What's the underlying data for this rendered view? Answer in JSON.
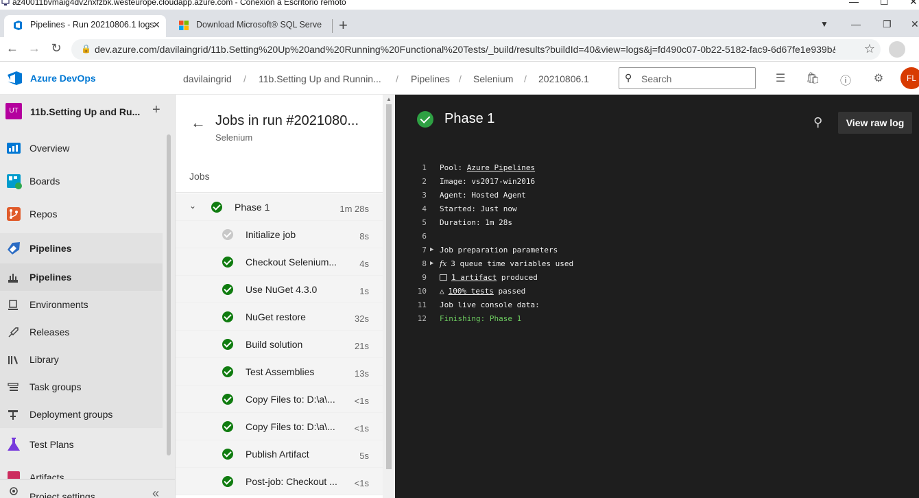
{
  "rdp": {
    "title": "az40011bvmaig4dv2nxfzbk.westeurope.cloudapp.azure.com - Conexión a Escritorio remoto"
  },
  "browser": {
    "tabs": [
      {
        "label": "Pipelines - Run 20210806.1 logs",
        "active": true
      },
      {
        "label": "Download Microsoft® SQL Serve",
        "active": false
      }
    ],
    "url": "dev.azure.com/davilaingrid/11b.Setting%20Up%20and%20Running%20Functional%20Tests/_build/results?buildId=40&view=logs&j=fd490c07-0b22-5182-fac9-6d67fe1e939b&t..."
  },
  "header": {
    "product": "Azure DevOps",
    "breadcrumbs": [
      "davilaingrid",
      "11b.Setting Up and Runnin...",
      "Pipelines",
      "Selenium",
      "20210806.1"
    ],
    "search_placeholder": "Search",
    "avatar_initials": "FL"
  },
  "project": {
    "badge": "UT",
    "name": "11b.Setting Up and Ru...",
    "badge_color": "#b4009e"
  },
  "nav": {
    "overview": "Overview",
    "boards": "Boards",
    "repos": "Repos",
    "pipelines_group": "Pipelines",
    "pipelines": "Pipelines",
    "environments": "Environments",
    "releases": "Releases",
    "library": "Library",
    "task_groups": "Task groups",
    "deployment_groups": "Deployment groups",
    "test_plans": "Test Plans",
    "artifacts": "Artifacts",
    "project_settings": "Project settings"
  },
  "jobs": {
    "title": "Jobs in run #2021080...",
    "subtitle": "Selenium",
    "section": "Jobs",
    "phase": {
      "name": "Phase 1",
      "duration": "1m 28s"
    },
    "steps": [
      {
        "name": "Initialize job",
        "duration": "8s",
        "status": "skipped"
      },
      {
        "name": "Checkout Selenium...",
        "duration": "4s",
        "status": "succeeded"
      },
      {
        "name": "Use NuGet 4.3.0",
        "duration": "1s",
        "status": "succeeded"
      },
      {
        "name": "NuGet restore",
        "duration": "32s",
        "status": "succeeded"
      },
      {
        "name": "Build solution",
        "duration": "21s",
        "status": "succeeded"
      },
      {
        "name": "Test Assemblies",
        "duration": "13s",
        "status": "succeeded"
      },
      {
        "name": "Copy Files to: D:\\a\\...",
        "duration": "<1s",
        "status": "succeeded"
      },
      {
        "name": "Copy Files to: D:\\a\\...",
        "duration": "<1s",
        "status": "succeeded"
      },
      {
        "name": "Publish Artifact",
        "duration": "5s",
        "status": "succeeded"
      },
      {
        "name": "Post-job: Checkout ...",
        "duration": "<1s",
        "status": "succeeded"
      }
    ]
  },
  "log": {
    "title": "Phase 1",
    "raw_button": "View raw log",
    "lines": {
      "l1": {
        "no": "1",
        "prefix": "Pool: ",
        "link": "Azure Pipelines"
      },
      "l2": {
        "no": "2",
        "text": "Image: vs2017-win2016"
      },
      "l3": {
        "no": "3",
        "text": "Agent: Hosted Agent"
      },
      "l4": {
        "no": "4",
        "text": "Started: Just now"
      },
      "l5": {
        "no": "5",
        "text": "Duration: 1m 28s"
      },
      "l6": {
        "no": "6",
        "text": ""
      },
      "l7": {
        "no": "7",
        "text": "Job preparation parameters"
      },
      "l8": {
        "no": "8",
        "text": "3 queue time variables used"
      },
      "l9": {
        "no": "9",
        "link": "1 artifact",
        "suffix": " produced"
      },
      "l10": {
        "no": "10",
        "link": "100% tests",
        "suffix": " passed"
      },
      "l11": {
        "no": "11",
        "text": "Job live console data:"
      },
      "l12": {
        "no": "12",
        "text": "Finishing: Phase 1"
      }
    }
  },
  "colors": {
    "accent": "#0078d4",
    "success": "#107c10",
    "log_bg": "#1e1e1e",
    "finishing": "#6ccb5f"
  }
}
